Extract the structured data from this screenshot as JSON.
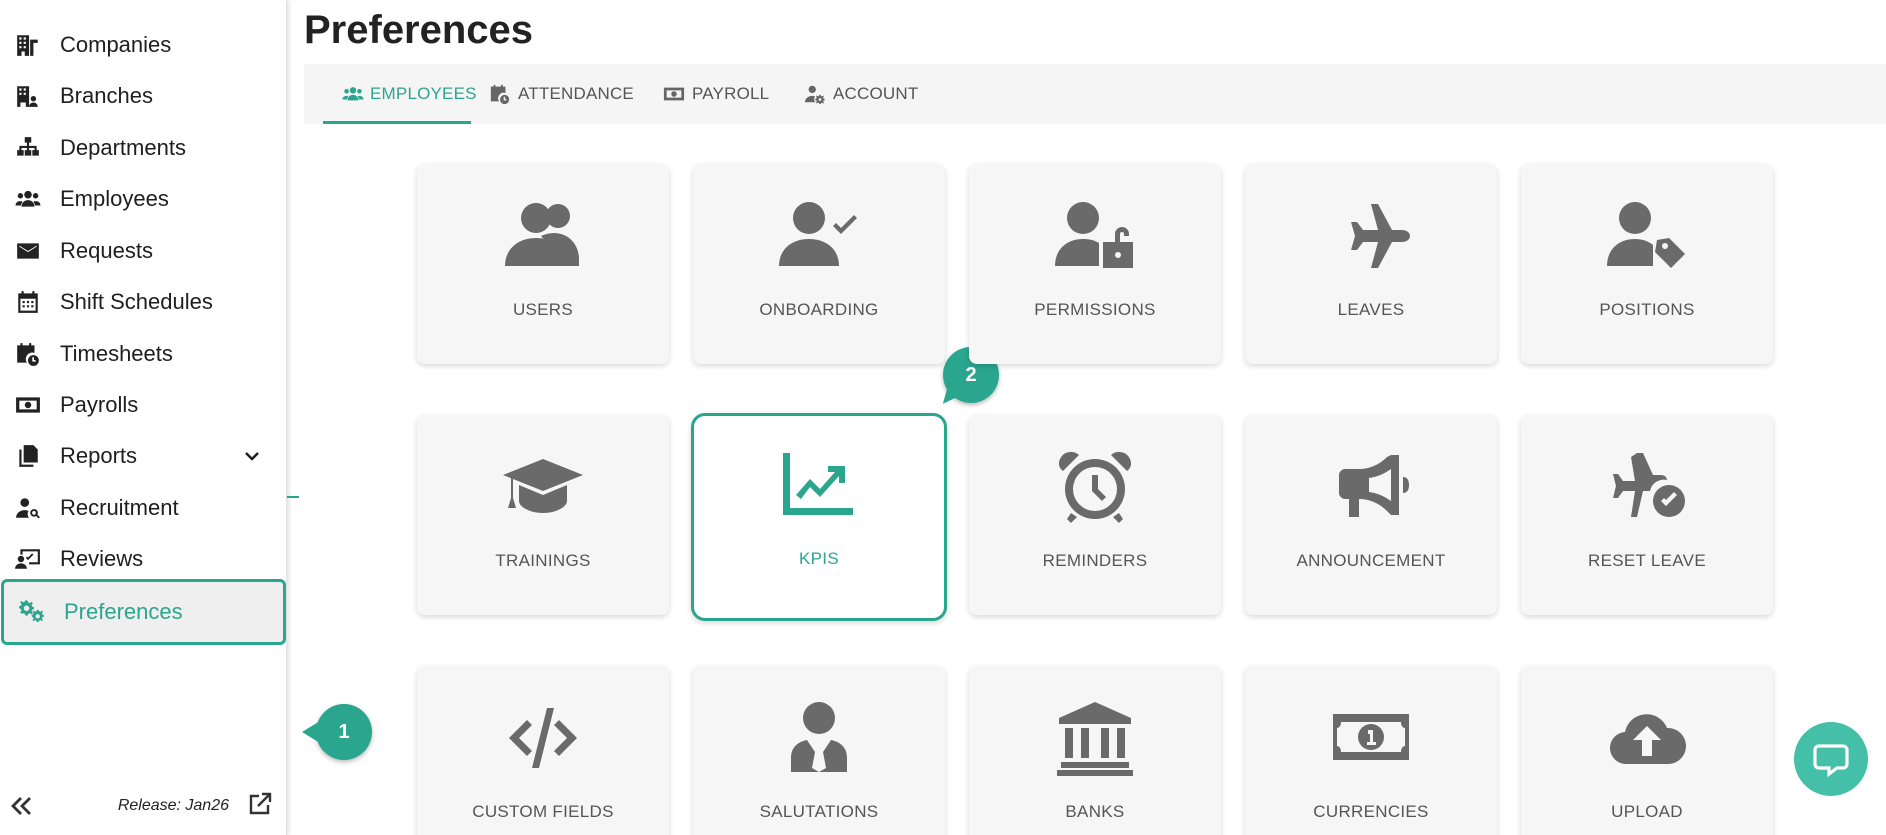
{
  "sidebar": {
    "items": [
      {
        "label": "Companies",
        "icon": "building-icon"
      },
      {
        "label": "Branches",
        "icon": "branch-building-icon"
      },
      {
        "label": "Departments",
        "icon": "sitemap-icon"
      },
      {
        "label": "Employees",
        "icon": "users-icon"
      },
      {
        "label": "Requests",
        "icon": "envelope-icon"
      },
      {
        "label": "Shift Schedules",
        "icon": "calendar-icon"
      },
      {
        "label": "Timesheets",
        "icon": "calendar-clock-icon"
      },
      {
        "label": "Payrolls",
        "icon": "money-icon"
      },
      {
        "label": "Reports",
        "icon": "copy-icon"
      },
      {
        "label": "Recruitment",
        "icon": "user-search-icon"
      },
      {
        "label": "Reviews",
        "icon": "review-icon"
      },
      {
        "label": "Preferences",
        "icon": "gears-icon"
      }
    ],
    "active": "Preferences",
    "release": "Release: Jan26"
  },
  "page": {
    "title": "Preferences"
  },
  "tabs": [
    {
      "label": "EMPLOYEES",
      "icon": "users-icon",
      "active": true
    },
    {
      "label": "ATTENDANCE",
      "icon": "calendar-clock-icon",
      "active": false
    },
    {
      "label": "PAYROLL",
      "icon": "money-icon",
      "active": false
    },
    {
      "label": "ACCOUNT",
      "icon": "user-gear-icon",
      "active": false
    }
  ],
  "cards": [
    {
      "label": "USERS",
      "icon": "users-icon"
    },
    {
      "label": "ONBOARDING",
      "icon": "user-check-icon"
    },
    {
      "label": "PERMISSIONS",
      "icon": "user-lock-icon"
    },
    {
      "label": "LEAVES",
      "icon": "plane-icon"
    },
    {
      "label": "POSITIONS",
      "icon": "user-tag-icon"
    },
    {
      "label": "TRAININGS",
      "icon": "graduation-cap-icon"
    },
    {
      "label": "KPIS",
      "icon": "chart-line-icon"
    },
    {
      "label": "REMINDERS",
      "icon": "alarm-clock-icon"
    },
    {
      "label": "ANNOUNCEMENT",
      "icon": "megaphone-icon"
    },
    {
      "label": "RESET LEAVE",
      "icon": "plane-check-icon"
    },
    {
      "label": "CUSTOM FIELDS",
      "icon": "code-icon"
    },
    {
      "label": "SALUTATIONS",
      "icon": "user-tie-icon"
    },
    {
      "label": "BANKS",
      "icon": "bank-icon"
    },
    {
      "label": "CURRENCIES",
      "icon": "money-bill-icon"
    },
    {
      "label": "UPLOAD",
      "icon": "cloud-upload-icon"
    }
  ],
  "selected_card": "KPIS",
  "callouts": [
    "1",
    "2"
  ],
  "colors": {
    "accent": "#2aa58e",
    "chat": "#44bfa8",
    "icon_gray": "#6a6a6a"
  }
}
